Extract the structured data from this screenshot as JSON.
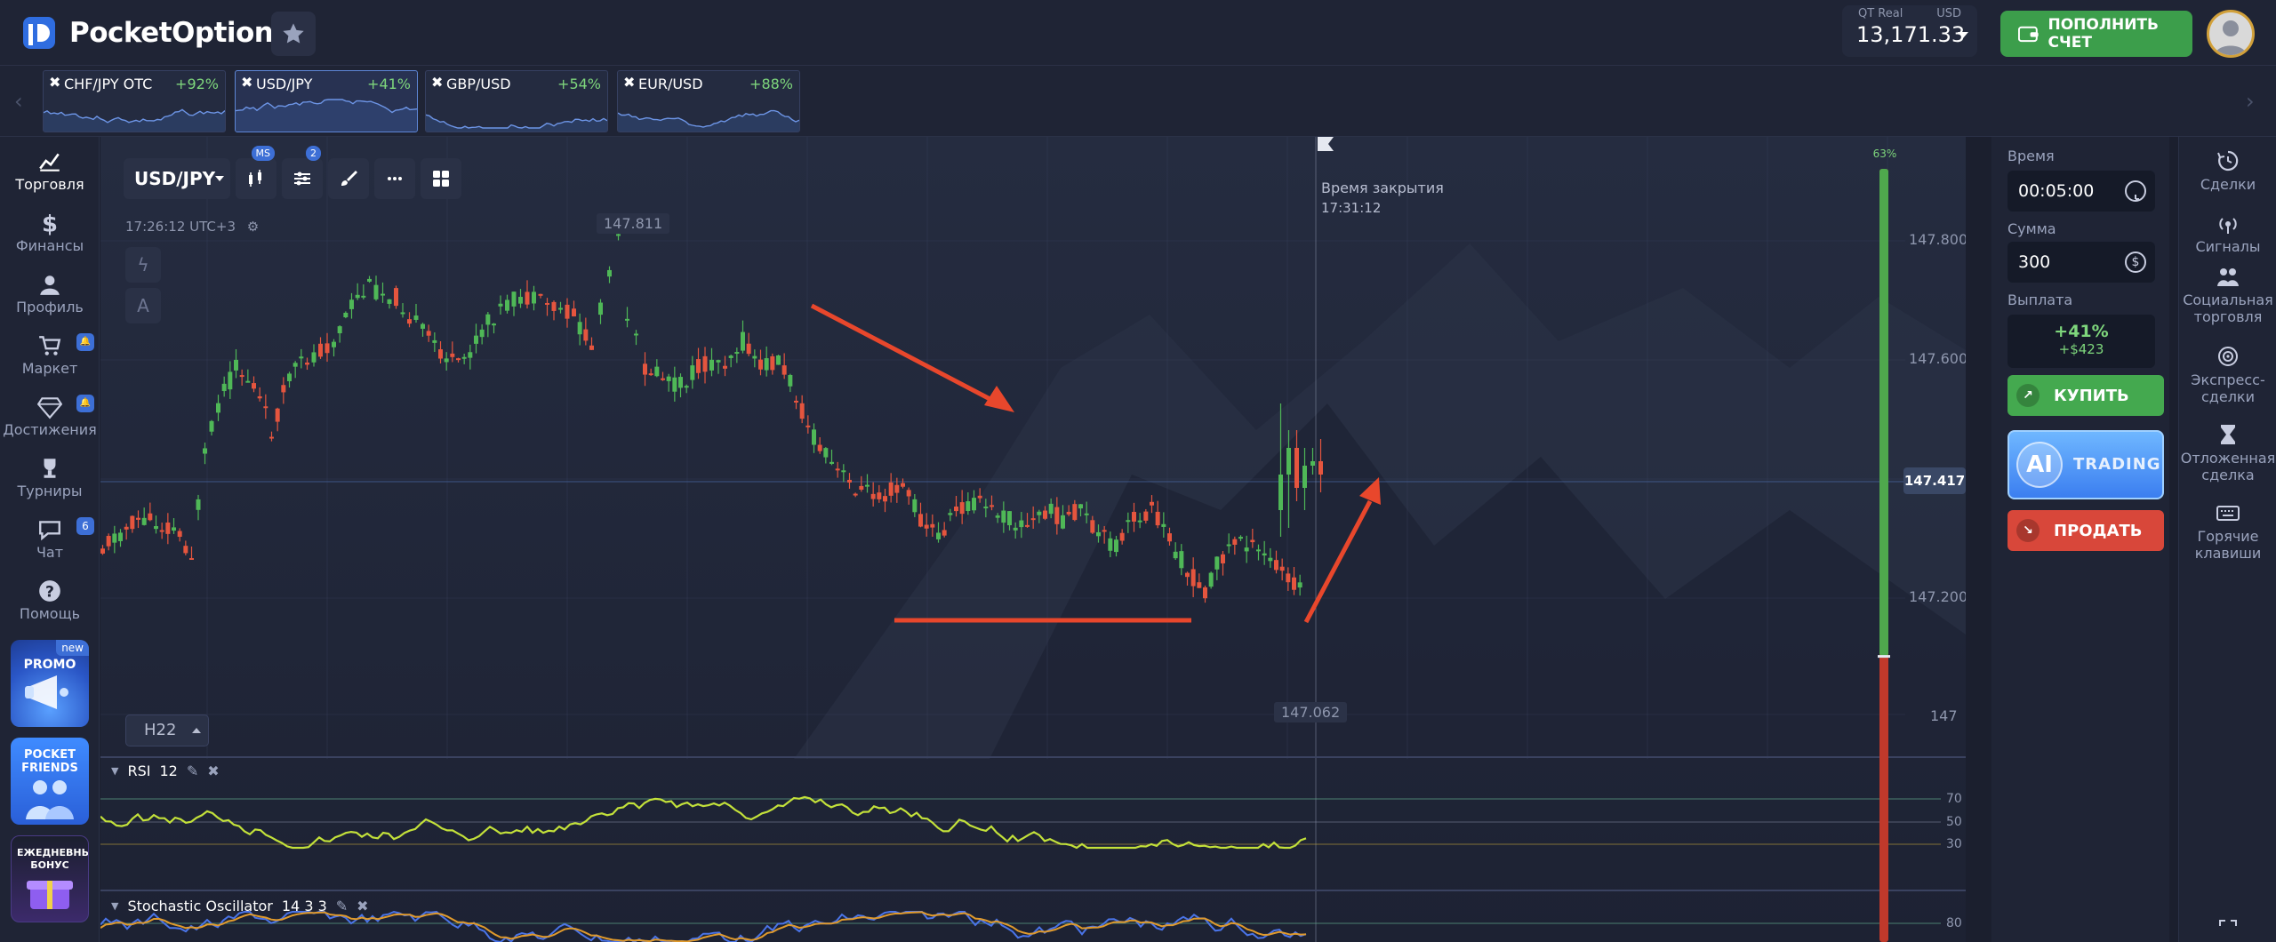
{
  "header": {
    "brand": "PocketOption",
    "account_type": "QT Real",
    "currency": "USD",
    "balance": "13,171.33",
    "deposit_label": "ПОПОЛНИТЬ СЧЕТ"
  },
  "assets": [
    {
      "name": "CHF/JPY OTC",
      "payout": "+92%",
      "active": false
    },
    {
      "name": "USD/JPY",
      "payout": "+41%",
      "active": true
    },
    {
      "name": "GBP/USD",
      "payout": "+54%",
      "active": false
    },
    {
      "name": "EUR/USD",
      "payout": "+88%",
      "active": false
    }
  ],
  "leftnav": {
    "items": [
      {
        "label": "Торговля",
        "icon": "chart-line-icon"
      },
      {
        "label": "Финансы",
        "icon": "dollar-icon"
      },
      {
        "label": "Профиль",
        "icon": "user-icon"
      },
      {
        "label": "Маркет",
        "icon": "cart-icon"
      },
      {
        "label": "Достижения",
        "icon": "diamond-icon"
      },
      {
        "label": "Турниры",
        "icon": "trophy-icon"
      },
      {
        "label": "Чат",
        "icon": "chat-icon",
        "badge": "6"
      },
      {
        "label": "Помощь",
        "icon": "help-icon"
      }
    ],
    "promo": {
      "title": "PROMO",
      "badge": "new"
    },
    "friends": {
      "title": "POCKET FRIENDS"
    },
    "bonus": {
      "title": "ЕЖЕДНЕВНЫЙ БОНУС"
    }
  },
  "chart": {
    "pair": "USD/JPY",
    "toolbar_badges": {
      "indicators": "MS",
      "settings": "2"
    },
    "server_time": "17:26:12 UTC+3",
    "close_title": "Время закрытия",
    "close_time": "17:31:12",
    "high_tag": "147.811",
    "low_tag": "147.062",
    "current_price": "147.417",
    "y_labels": [
      "147.800",
      "147.600",
      "147.200",
      "147"
    ],
    "timeframe": "H22",
    "progress_pct": "63%",
    "rsi": {
      "name": "RSI",
      "period": "12",
      "levels": [
        "70",
        "50",
        "30"
      ]
    },
    "stoch": {
      "name": "Stochastic Oscillator",
      "params": "14 3 3",
      "level": "80"
    }
  },
  "trade": {
    "time_label": "Время",
    "time_value": "00:05:00",
    "amount_label": "Сумма",
    "amount_value": "300",
    "payout_label": "Выплата",
    "payout_pct": "+41%",
    "payout_amount": "+$423",
    "buy_label": "КУПИТЬ",
    "ai_short": "AI",
    "ai_label": "TRADING",
    "sell_label": "ПРОДАТЬ"
  },
  "rightnav": {
    "items": [
      {
        "label": "Сделки",
        "icon": "history-icon"
      },
      {
        "label": "Сигналы",
        "icon": "signal-icon"
      },
      {
        "label": "Социальная торговля",
        "icon": "people-icon"
      },
      {
        "label": "Экспресс-сделки",
        "icon": "target-icon"
      },
      {
        "label": "Отложенная сделка",
        "icon": "hourglass-icon"
      },
      {
        "label": "Горячие клавиши",
        "icon": "keyboard-icon"
      }
    ]
  },
  "colors": {
    "up": "#4fb857",
    "down": "#e5553e",
    "accent": "#3d6fd6",
    "rsi_line": "#c3e13a",
    "annotation": "#e8472c"
  }
}
